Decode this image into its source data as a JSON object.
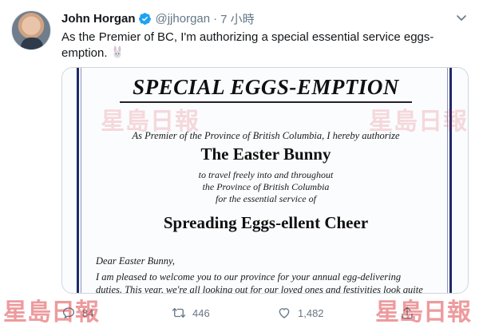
{
  "tweet": {
    "author": {
      "display_name": "John Horgan",
      "handle": "@jjhorgan",
      "verified": true
    },
    "separator": "·",
    "timestamp": "7 小時",
    "text": "As the Premier of BC, I'm authorizing a special essential service eggs-emption.",
    "emoji_icon": "rabbit-face-icon"
  },
  "media": {
    "title": "SPECIAL EGGS-EMPTION",
    "authorization_line": "As Premier of the Province of British Columbia, I hereby authorize",
    "recipient": "The Easter Bunny",
    "travel_lines": [
      "to travel freely into and throughout",
      "the Province of British Columbia",
      "for the essential service of"
    ],
    "purpose": "Spreading Eggs-ellent Cheer",
    "salutation": "Dear Easter Bunny,",
    "body_lines": [
      "I am pleased to welcome you to our province for your annual egg-delivering",
      "duties. This year, we're all looking out for our loved ones and festivities look quite"
    ],
    "watermark_text": "星島日報",
    "border_color": "#1f2a6b"
  },
  "actions": {
    "reply_count": "84",
    "retweet_count": "446",
    "like_count": "1,482"
  },
  "colors": {
    "text": "#14171a",
    "secondary": "#657786",
    "verified": "#1da1f2",
    "watermark": "#d8232a"
  }
}
